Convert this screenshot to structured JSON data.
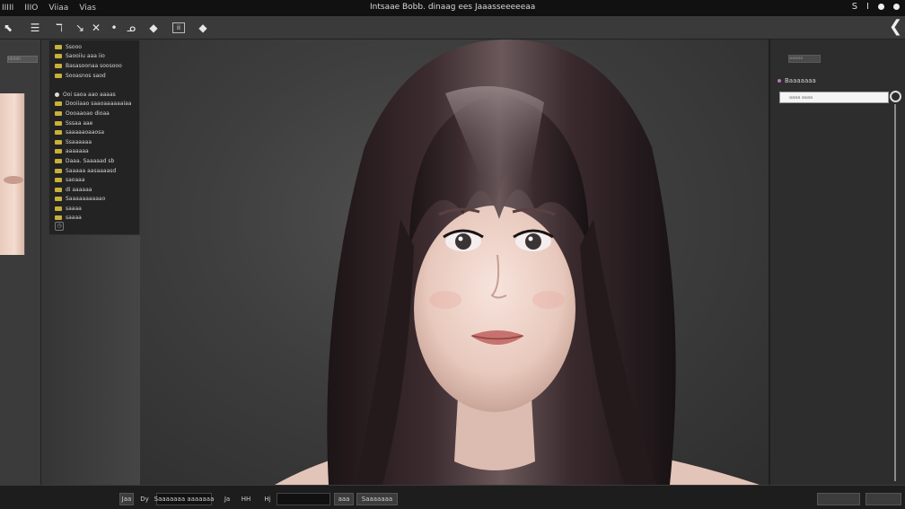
{
  "menubar": {
    "items": [
      "IIIII",
      "IIIO",
      "Viiaa",
      "Vias"
    ],
    "title": "Intsaae Bobb. dinaag ees   Jaaasseeeeeaa",
    "system": [
      "S",
      "I"
    ]
  },
  "toolbar": {
    "tools": [
      {
        "icon": "arrow-icon",
        "glyph": "⬉"
      },
      {
        "icon": "menu-icon",
        "glyph": "☰"
      },
      {
        "icon": "pen-icon",
        "glyph": "ℸ"
      },
      {
        "icon": "brush-icon",
        "glyph": "↘"
      },
      {
        "icon": "cross-icon",
        "glyph": "✕"
      },
      {
        "icon": "dot-icon",
        "glyph": "•"
      },
      {
        "icon": "lasso-icon",
        "glyph": "ᓄ"
      },
      {
        "icon": "fill-icon",
        "glyph": "◆"
      },
      {
        "icon": "frame-icon",
        "glyph": "ii"
      },
      {
        "icon": "diamond-icon",
        "glyph": "◆"
      }
    ],
    "right_glyph": "❮"
  },
  "leftdock": {
    "tab_label": "iiiiiiiiii"
  },
  "layers": {
    "items": [
      {
        "label": "Ssooo",
        "icon": "yellow"
      },
      {
        "label": "Saooiiu aaa iio",
        "icon": "yellow"
      },
      {
        "label": "Basasoonaa soosooo",
        "icon": "yellow"
      },
      {
        "label": "Sooasnos saod",
        "icon": "yellow"
      },
      {
        "label": "",
        "icon": "none"
      },
      {
        "label": "Ooi saoa aao aaaas",
        "icon": "white"
      },
      {
        "label": "Dooiiaao saaoaaaaaaiaa",
        "icon": "yellow"
      },
      {
        "label": "Oooaaoao dioaa",
        "icon": "yellow"
      },
      {
        "label": "Sssaa aae",
        "icon": "yellow"
      },
      {
        "label": "saaaaaoaaosa",
        "icon": "yellow"
      },
      {
        "label": "Ssaaaaaa",
        "icon": "yellow"
      },
      {
        "label": "aaaaaaa",
        "icon": "yellow"
      },
      {
        "label": "Daaa. Saaaaad  sb",
        "icon": "yellow"
      },
      {
        "label": "Saaaaa  aasaaaasd",
        "icon": "yellow"
      },
      {
        "label": "saoaaa",
        "icon": "yellow"
      },
      {
        "label": "di aaaaaa",
        "icon": "yellow"
      },
      {
        "label": "Saaaaaaaaaao",
        "icon": "yellow"
      },
      {
        "label": "saaaa",
        "icon": "yellow"
      },
      {
        "label": "saaaa",
        "icon": "yellow"
      }
    ],
    "footer_glyph": "◷"
  },
  "rightdock": {
    "tab_label": "aaaaa",
    "heading": "Baaaaaaa",
    "input_placeholder": "aaaa aaaa"
  },
  "statusbar": {
    "fields": [
      {
        "label": "Jaa",
        "style": "light"
      },
      {
        "label": "Dy",
        "style": "plain"
      },
      {
        "label": "Saaaaaaa aaaaaaa",
        "style": "dark"
      },
      {
        "label": "Ja",
        "style": "plain"
      },
      {
        "label": "HH",
        "style": "plain"
      },
      {
        "label": "Hj",
        "style": "plain"
      },
      {
        "label": "",
        "style": "dark"
      },
      {
        "label": "aaa",
        "style": "light"
      },
      {
        "label": "Saaaaaaa",
        "style": "light"
      },
      {
        "label": "",
        "style": "light"
      },
      {
        "label": "",
        "style": "light"
      }
    ]
  },
  "colors": {
    "layer_icon": "#c8b03a",
    "canvas_bg": "#3e3e3e",
    "hair": "#2a1f22",
    "skin": "#f0d8cf"
  }
}
